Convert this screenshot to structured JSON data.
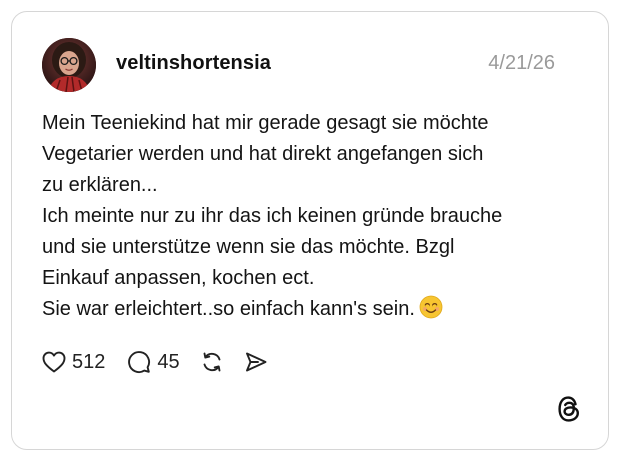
{
  "post": {
    "username": "veltinshortensia",
    "date": "4/21/26",
    "text_lines": [
      "Mein Teeniekind hat mir gerade gesagt sie möchte",
      "Vegetarier werden und hat direkt angefangen sich",
      "zu erklären...",
      "Ich meinte nur zu ihr das ich keinen gründe brauche",
      "und sie unterstütze wenn sie das möchte. Bzgl",
      "Einkauf anpassen, kochen ect.",
      "Sie war erleichtert..so einfach kann's sein."
    ],
    "emoji": "smiling-face-emoji"
  },
  "actions": {
    "likes": "512",
    "replies": "45",
    "like_icon": "heart-icon",
    "reply_icon": "speech-bubble-icon",
    "repost_icon": "repost-icon",
    "share_icon": "send-icon"
  },
  "branding": {
    "logo": "threads-logo-icon"
  },
  "colors": {
    "border": "#d6d6d6",
    "date": "#9a9a9a",
    "text": "#141414",
    "emoji": "#f7c531"
  }
}
